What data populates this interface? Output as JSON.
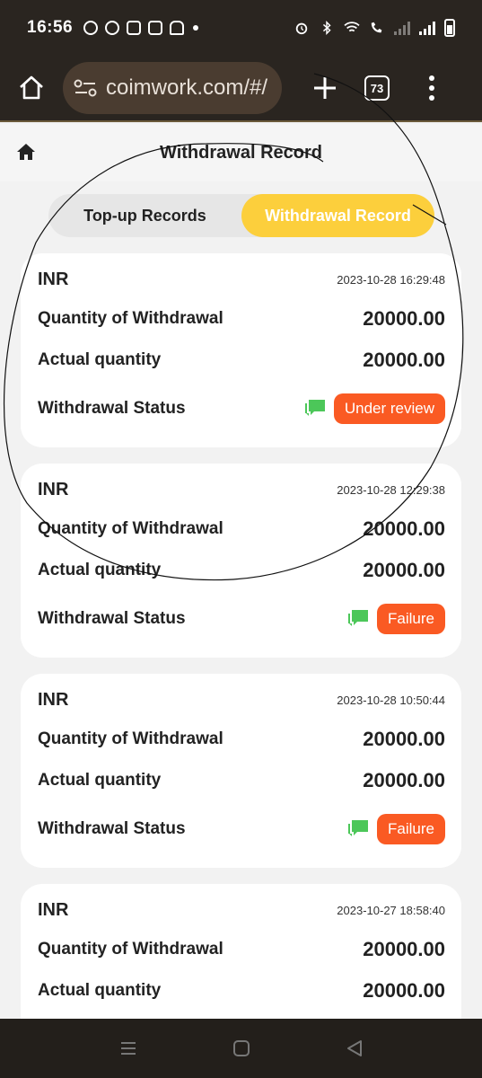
{
  "status_bar": {
    "time": "16:56",
    "icons_left": [
      "whatsapp-icon",
      "messenger-icon",
      "app-icon",
      "app-icon-2",
      "snapchat-icon"
    ],
    "icons_right": [
      "alarm-icon",
      "bluetooth-icon",
      "wifi-icon",
      "wifi-call-icon",
      "signal-icon",
      "signal-icon-2",
      "battery-icon"
    ]
  },
  "browser": {
    "url": "coimwork.com/#/",
    "tab_count": "73"
  },
  "header": {
    "title": "Withdrawal Record"
  },
  "tabs": {
    "topup_label": "Top-up Records",
    "withdraw_label": "Withdrawal Record",
    "active": "withdraw"
  },
  "labels": {
    "quantity": "Quantity of Withdrawal",
    "actual": "Actual quantity",
    "status": "Withdrawal Status"
  },
  "records": [
    {
      "currency": "INR",
      "datetime": "2023-10-28 16:29:48",
      "quantity": "20000.00",
      "actual": "20000.00",
      "status": "Under review"
    },
    {
      "currency": "INR",
      "datetime": "2023-10-28 12:29:38",
      "quantity": "20000.00",
      "actual": "20000.00",
      "status": "Failure"
    },
    {
      "currency": "INR",
      "datetime": "2023-10-28 10:50:44",
      "quantity": "20000.00",
      "actual": "20000.00",
      "status": "Failure"
    },
    {
      "currency": "INR",
      "datetime": "2023-10-27 18:58:40",
      "quantity": "20000.00",
      "actual": "20000.00",
      "status": ""
    }
  ],
  "colors": {
    "accent": "#fccf3c",
    "status_badge": "#fa5a23",
    "chat_icon": "#4cc759",
    "chrome_bg": "#2a2520"
  }
}
